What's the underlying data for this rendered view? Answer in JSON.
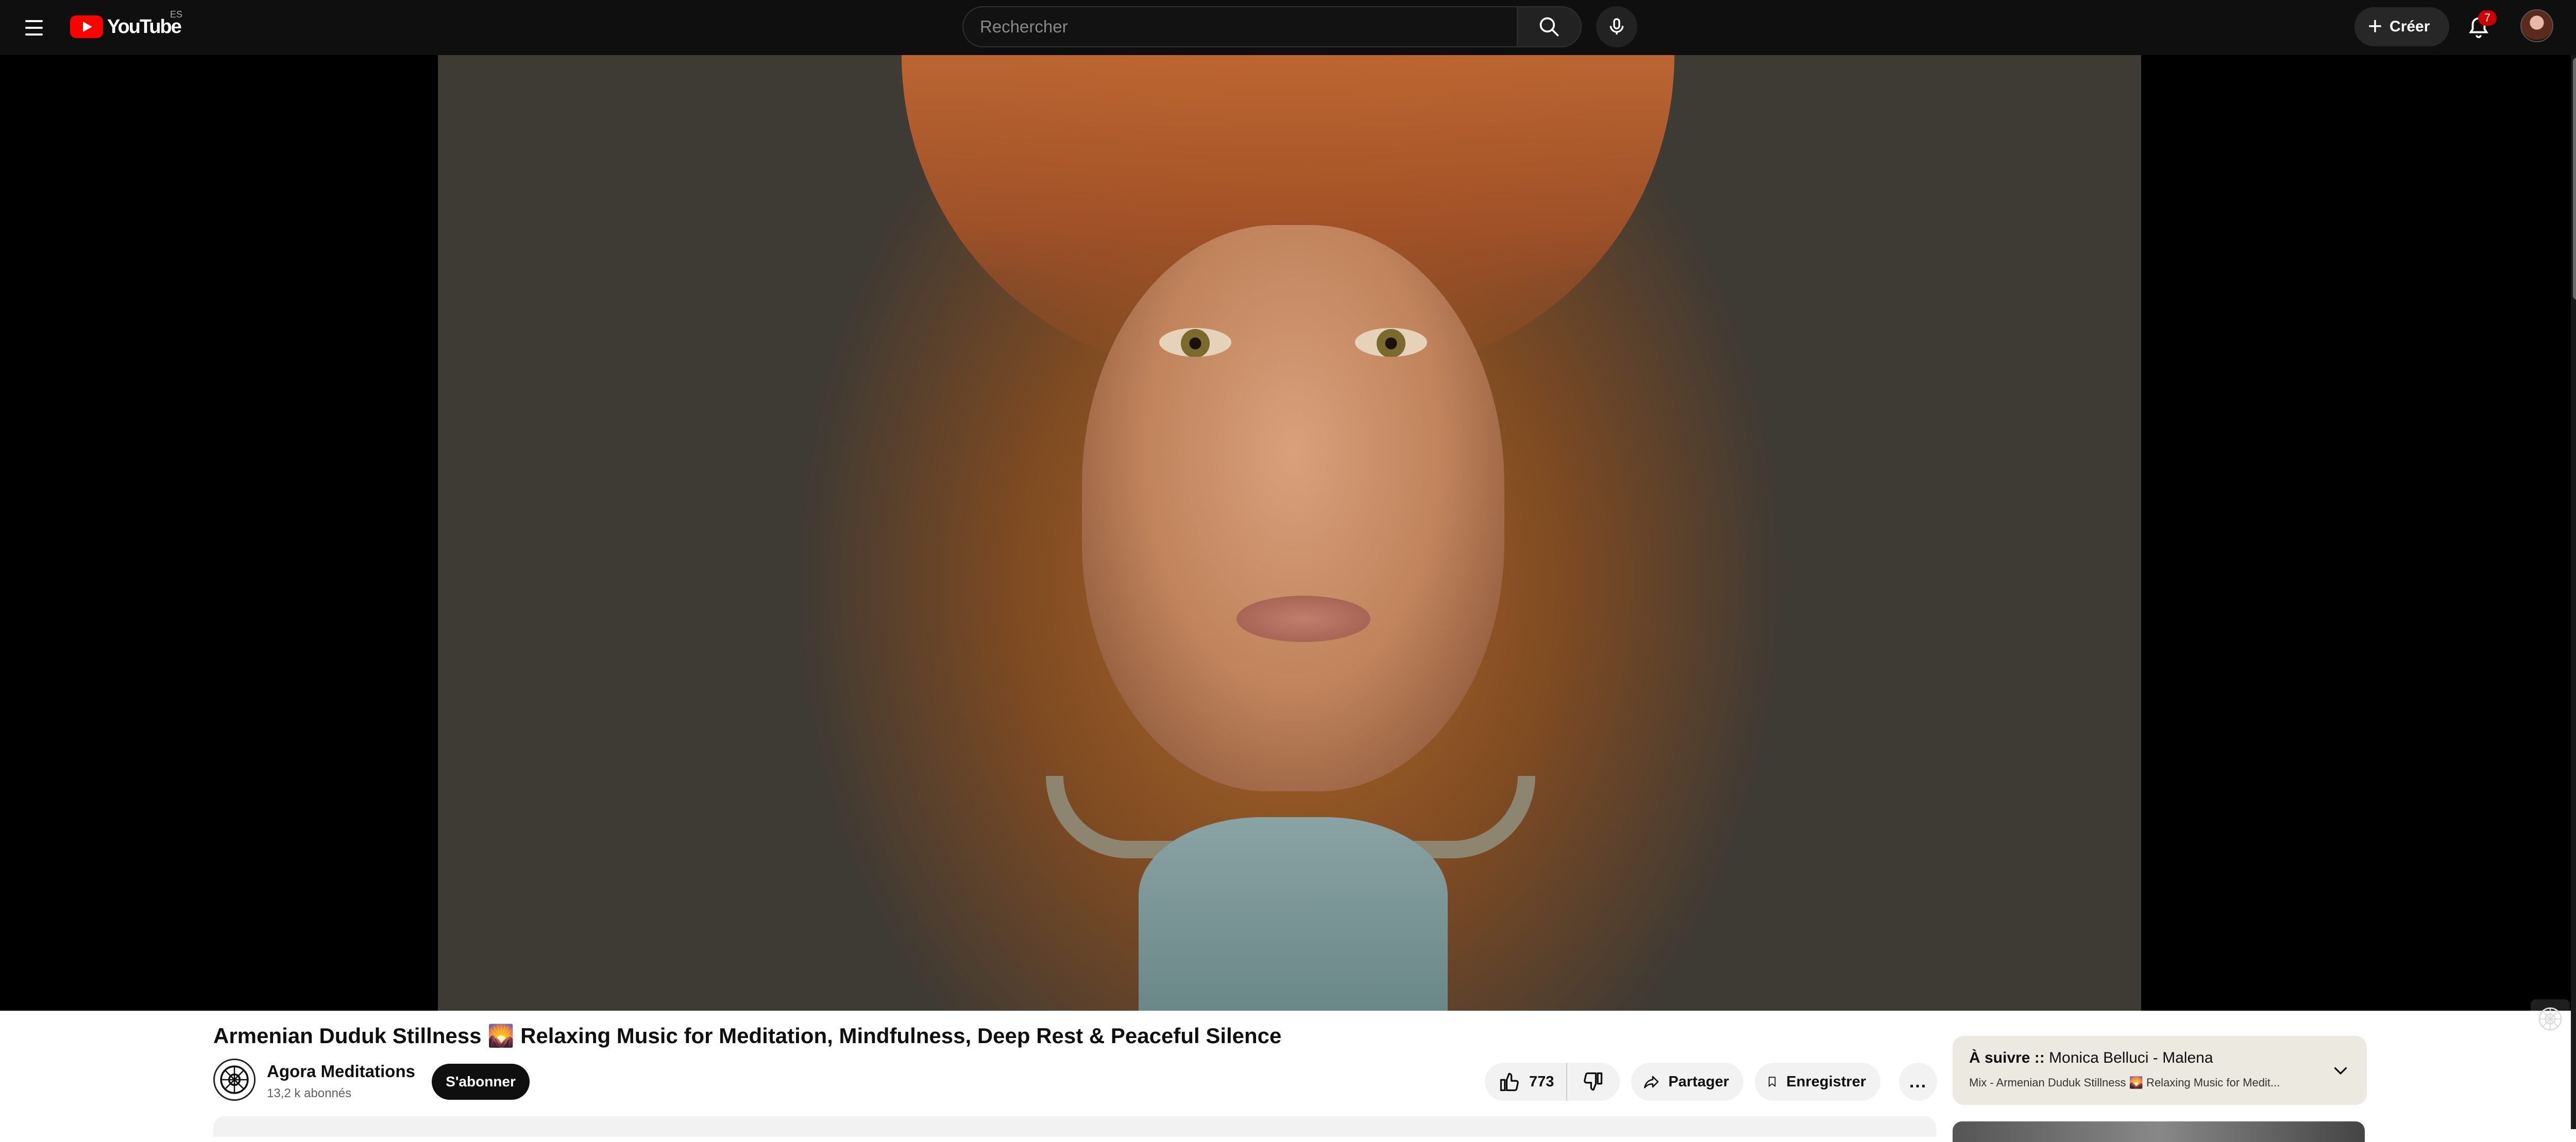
{
  "header": {
    "logo_text": "YouTube",
    "country_code": "ES",
    "search_placeholder": "Rechercher",
    "create_label": "Créer",
    "notification_count": "7",
    "icons": [
      "menu-icon",
      "search-icon",
      "microphone-icon",
      "plus-icon",
      "bell-icon"
    ]
  },
  "video": {
    "title": "Armenian Duduk Stillness 🌄 Relaxing Music for Meditation, Mindfulness, Deep Rest & Peaceful Silence"
  },
  "channel": {
    "name": "Agora Meditations",
    "subscribers": "13,2 k abonnés",
    "subscribe_label": "S'abonner"
  },
  "actions": {
    "like_count": "773",
    "share_label": "Partager",
    "save_label": "Enregistrer",
    "more_label": "..."
  },
  "up_next": {
    "prefix": "À suivre ::",
    "title": " Monica Belluci - Malena",
    "subtitle": "Mix - Armenian Duduk Stillness 🌄 Relaxing Music for Medit..."
  },
  "colors": {
    "topbar": "#0f0f0f",
    "brand_red": "#ff0000",
    "badge_red": "#cc0000",
    "pill_bg": "#f2f2f2",
    "upnext_bg": "#ebe9e0"
  }
}
